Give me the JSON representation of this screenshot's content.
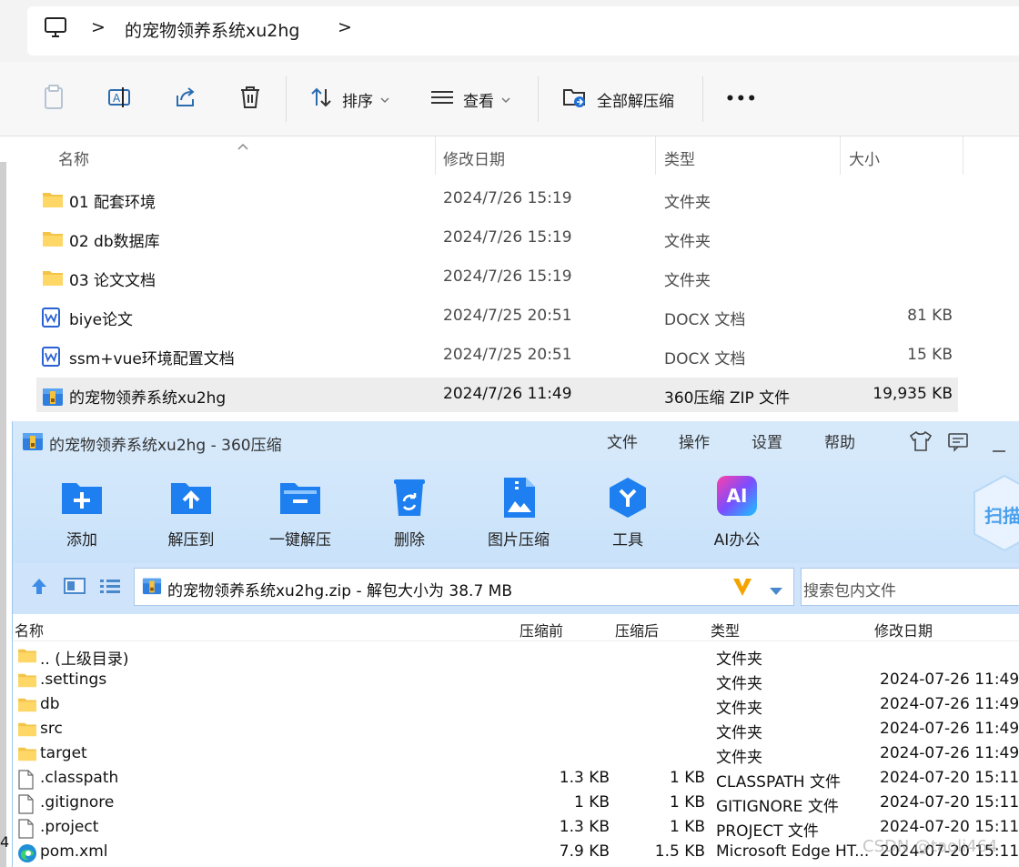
{
  "explorer": {
    "breadcrumb": {
      "separator": ">",
      "folder": "的宠物领养系统xu2hg",
      "trail_separator": ">"
    },
    "toolbar": {
      "sort_label": "排序",
      "view_label": "查看",
      "extract_all_label": "全部解压缩",
      "more_label": "•••"
    },
    "columns": {
      "name": "名称",
      "modified": "修改日期",
      "type": "类型",
      "size": "大小"
    },
    "rows": [
      {
        "name": "01 配套环境",
        "date": "2024/7/26 15:19",
        "type": "文件夹",
        "size": "",
        "icon": "folder-icon"
      },
      {
        "name": "02 db数据库",
        "date": "2024/7/26 15:19",
        "type": "文件夹",
        "size": "",
        "icon": "folder-icon"
      },
      {
        "name": "03 论文文档",
        "date": "2024/7/26 15:19",
        "type": "文件夹",
        "size": "",
        "icon": "folder-icon"
      },
      {
        "name": "biye论文",
        "date": "2024/7/25 20:51",
        "type": "DOCX 文档",
        "size": "81 KB",
        "icon": "wps-doc-icon"
      },
      {
        "name": "ssm+vue环境配置文档",
        "date": "2024/7/25 20:51",
        "type": "DOCX 文档",
        "size": "15 KB",
        "icon": "wps-doc-icon"
      },
      {
        "name": "的宠物领养系统xu2hg",
        "date": "2024/7/26 11:49",
        "type": "360压缩 ZIP 文件",
        "size": "19,935 KB",
        "icon": "zip-archive-icon",
        "selected": true
      }
    ],
    "left_number": "4"
  },
  "zip_window": {
    "title": "的宠物领养系统xu2hg - 360压缩",
    "menu": [
      "文件",
      "操作",
      "设置",
      "帮助"
    ],
    "tools": [
      "添加",
      "解压到",
      "一键解压",
      "删除",
      "图片压缩",
      "工具",
      "AI办公"
    ],
    "ai_badge": "AI",
    "scan_label": "扫描",
    "path_text": "的宠物领养系统xu2hg.zip - 解包大小为 38.7 MB",
    "search_placeholder": "搜索包内文件",
    "columns": {
      "name": "名称",
      "before": "压缩前",
      "after": "压缩后",
      "type": "类型",
      "modified": "修改日期"
    },
    "rows": [
      {
        "name": ".. (上级目录)",
        "before": "",
        "after": "",
        "type": "文件夹",
        "modified": "",
        "icon": "folder-icon"
      },
      {
        "name": ".settings",
        "before": "",
        "after": "",
        "type": "文件夹",
        "modified": "2024-07-26 11:49",
        "icon": "folder-icon"
      },
      {
        "name": "db",
        "before": "",
        "after": "",
        "type": "文件夹",
        "modified": "2024-07-26 11:49",
        "icon": "folder-icon"
      },
      {
        "name": "src",
        "before": "",
        "after": "",
        "type": "文件夹",
        "modified": "2024-07-26 11:49",
        "icon": "folder-icon"
      },
      {
        "name": "target",
        "before": "",
        "after": "",
        "type": "文件夹",
        "modified": "2024-07-26 11:49",
        "icon": "folder-icon"
      },
      {
        "name": ".classpath",
        "before": "1.3 KB",
        "after": "1 KB",
        "type": "CLASSPATH 文件",
        "modified": "2024-07-20 15:11",
        "icon": "file-icon"
      },
      {
        "name": ".gitignore",
        "before": "1 KB",
        "after": "1 KB",
        "type": "GITIGNORE 文件",
        "modified": "2024-07-20 15:11",
        "icon": "file-icon"
      },
      {
        "name": ".project",
        "before": "1.3 KB",
        "after": "1 KB",
        "type": "PROJECT 文件",
        "modified": "2024-07-20 15:11",
        "icon": "file-icon"
      },
      {
        "name": "pom.xml",
        "before": "7.9 KB",
        "after": "1.5 KB",
        "type": "Microsoft Edge HT...",
        "modified": "2024-07-20 15:11",
        "icon": "edge-icon"
      }
    ]
  },
  "watermark": "CSDN @taoli464"
}
